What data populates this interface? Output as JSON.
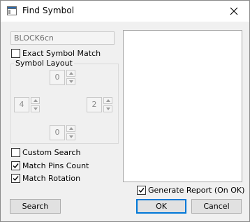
{
  "window": {
    "title": "Find Symbol",
    "icon": "window-app-icon",
    "close_icon": "close-icon"
  },
  "symbol_name": {
    "value": "BLOCK6cn"
  },
  "exact_match": {
    "label": "Exact Symbol Match",
    "checked": false
  },
  "layout": {
    "title": "Symbol Layout",
    "top": "0",
    "left": "4",
    "right": "2",
    "bottom": "0"
  },
  "options": {
    "custom_search": {
      "label": "Custom Search",
      "checked": false
    },
    "match_pins": {
      "label": "Match Pins Count",
      "checked": true
    },
    "match_rotation": {
      "label": "Match Rotation",
      "checked": true
    },
    "generate_report": {
      "label": "Generate Report (On OK)",
      "checked": true
    }
  },
  "buttons": {
    "search": "Search",
    "ok": "OK",
    "cancel": "Cancel"
  }
}
